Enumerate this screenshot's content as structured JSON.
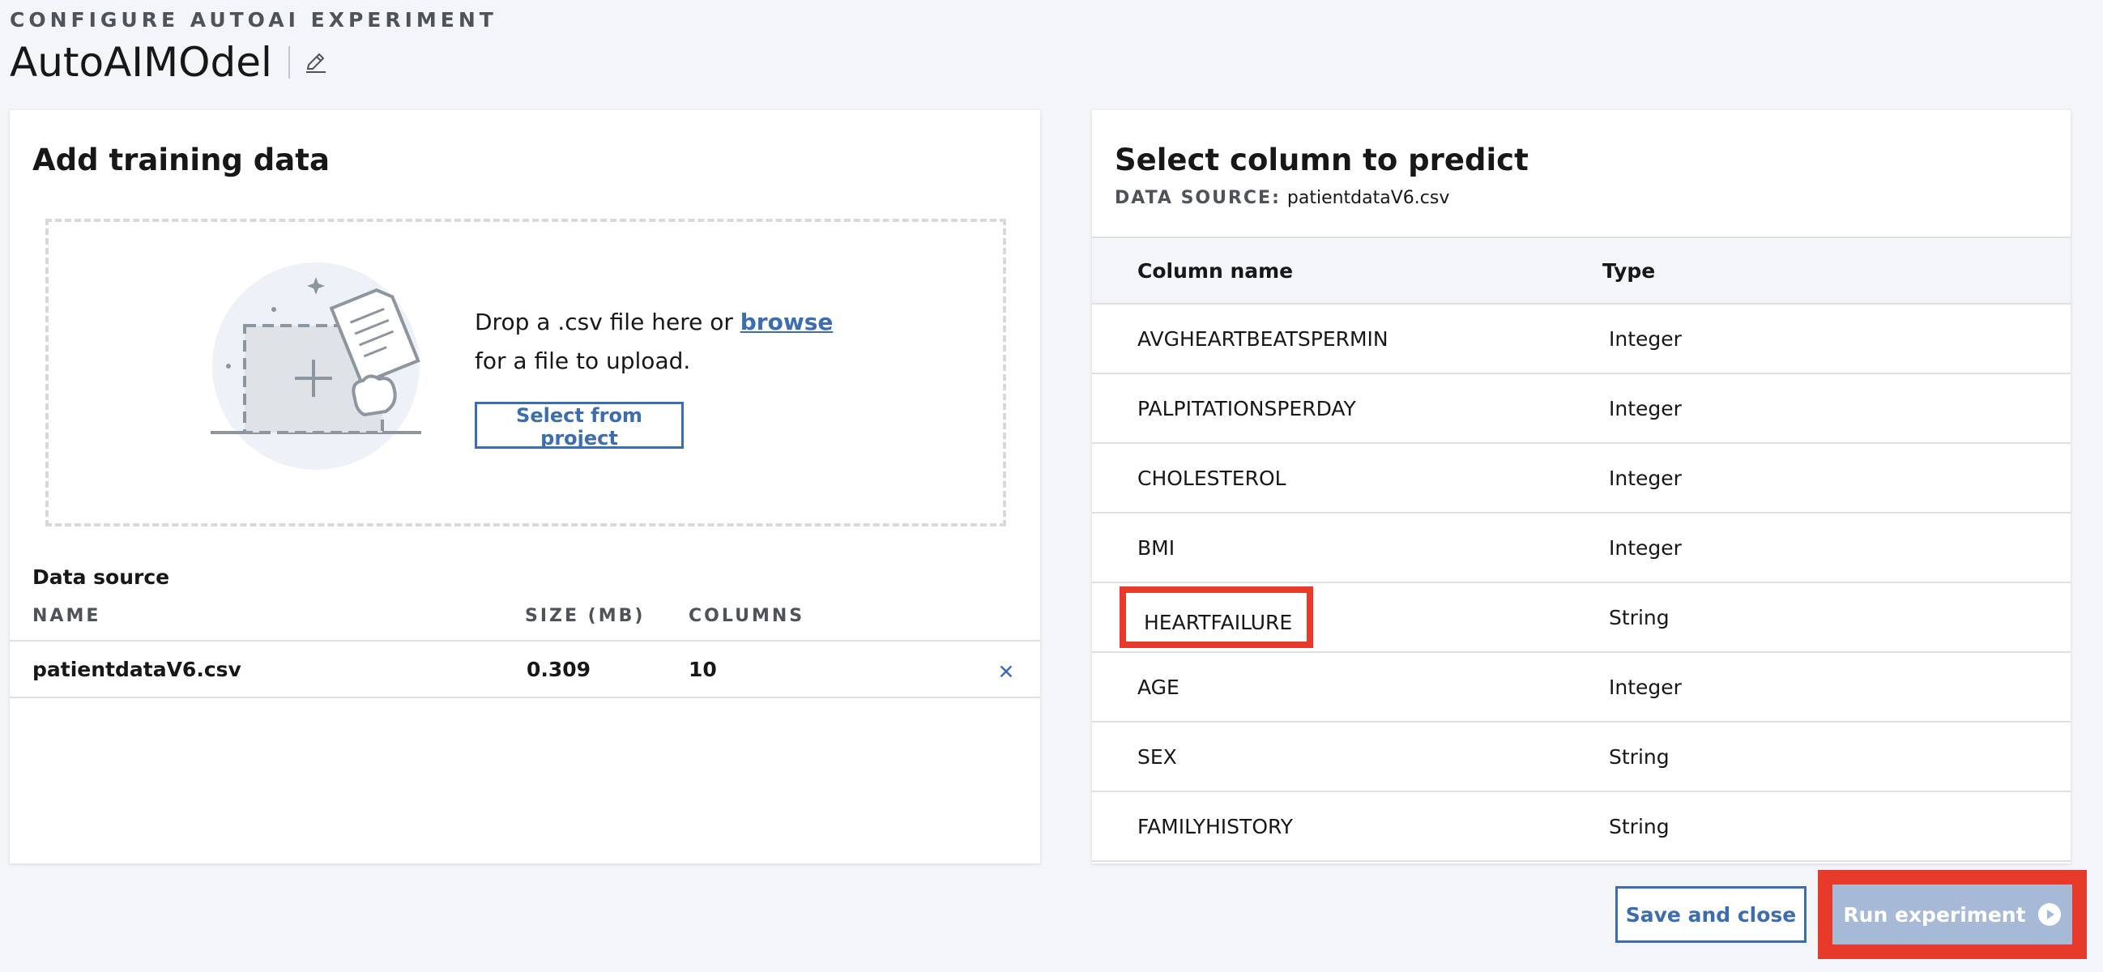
{
  "header": {
    "eyebrow": "CONFIGURE AUTOAI EXPERIMENT",
    "title": "AutoAIMOdel"
  },
  "training": {
    "title": "Add training data",
    "drop_text_before": "Drop a .csv file here or ",
    "drop_link": "browse",
    "drop_text_after": " for a file to upload.",
    "select_button": "Select from project",
    "data_source_label": "Data source",
    "headers": {
      "name": "NAME",
      "size": "SIZE (MB)",
      "columns": "COLUMNS"
    },
    "file": {
      "name": "patientdataV6.csv",
      "size": "0.309",
      "columns": "10",
      "remove": "✕"
    }
  },
  "predict": {
    "title": "Select column to predict",
    "source_key": "DATA SOURCE:",
    "source_value": "patientdataV6.csv",
    "headers": {
      "name": "Column name",
      "type": "Type"
    },
    "rows": [
      {
        "name": "AVGHEARTBEATSPERMIN",
        "type": "Integer"
      },
      {
        "name": "PALPITATIONSPERDAY",
        "type": "Integer"
      },
      {
        "name": "CHOLESTEROL",
        "type": "Integer"
      },
      {
        "name": "BMI",
        "type": "Integer"
      },
      {
        "name": "HEARTFAILURE",
        "type": "String"
      },
      {
        "name": "AGE",
        "type": "Integer"
      },
      {
        "name": "SEX",
        "type": "String"
      },
      {
        "name": "FAMILYHISTORY",
        "type": "String"
      }
    ]
  },
  "actions": {
    "save": "Save and close",
    "run": "Run experiment"
  },
  "colors": {
    "accent": "#3c6db0",
    "highlight": "#e83a2a",
    "run_disabled": "#a6b9d7"
  }
}
